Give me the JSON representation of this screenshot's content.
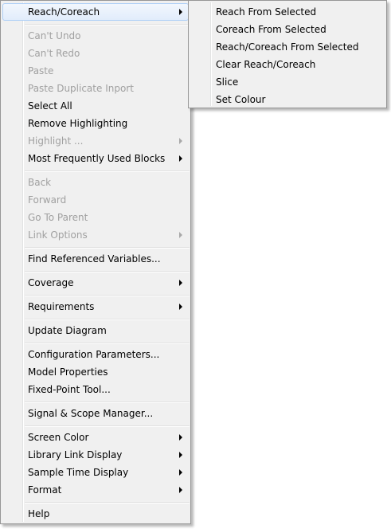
{
  "menu": {
    "items": [
      {
        "label": "Reach/Coreach",
        "disabled": false,
        "submenu": true
      },
      {
        "label": "Can't Undo",
        "disabled": true
      },
      {
        "label": "Can't Redo",
        "disabled": true
      },
      {
        "label": "Paste",
        "disabled": true
      },
      {
        "label": "Paste Duplicate Inport",
        "disabled": true
      },
      {
        "label": "Select All",
        "disabled": false
      },
      {
        "label": "Remove Highlighting",
        "disabled": false
      },
      {
        "label": "Highlight ...",
        "disabled": true,
        "submenu": true
      },
      {
        "label": "Most Frequently Used Blocks",
        "disabled": false,
        "submenu": true
      },
      {
        "label": "Back",
        "disabled": true
      },
      {
        "label": "Forward",
        "disabled": true
      },
      {
        "label": "Go To Parent",
        "disabled": true
      },
      {
        "label": "Link Options",
        "disabled": true,
        "submenu": true
      },
      {
        "label": "Find Referenced Variables...",
        "disabled": false
      },
      {
        "label": "Coverage",
        "disabled": false,
        "submenu": true
      },
      {
        "label": "Requirements",
        "disabled": false,
        "submenu": true
      },
      {
        "label": "Update Diagram",
        "disabled": false
      },
      {
        "label": "Configuration Parameters...",
        "disabled": false
      },
      {
        "label": "Model Properties",
        "disabled": false
      },
      {
        "label": "Fixed-Point Tool...",
        "disabled": false
      },
      {
        "label": "Signal & Scope Manager...",
        "disabled": false
      },
      {
        "label": "Screen Color",
        "disabled": false,
        "submenu": true
      },
      {
        "label": "Library Link Display",
        "disabled": false,
        "submenu": true
      },
      {
        "label": "Sample Time Display",
        "disabled": false,
        "submenu": true
      },
      {
        "label": "Format",
        "disabled": false,
        "submenu": true
      },
      {
        "label": "Help",
        "disabled": false
      }
    ]
  },
  "submenu": {
    "items": [
      {
        "label": "Reach From Selected"
      },
      {
        "label": "Coreach From Selected"
      },
      {
        "label": "Reach/Coreach From Selected"
      },
      {
        "label": "Clear Reach/Coreach"
      },
      {
        "label": "Slice"
      },
      {
        "label": "Set Colour"
      }
    ]
  }
}
